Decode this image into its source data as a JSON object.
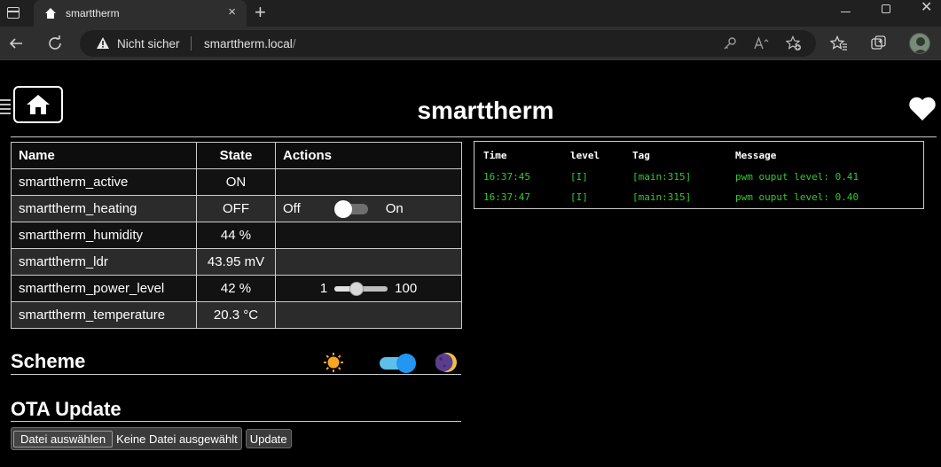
{
  "browser": {
    "tab_title": "smarttherm",
    "tab_close": "×",
    "new_tab": "+",
    "win_close": "✕",
    "not_secure": "Nicht sicher",
    "url_host": "smarttherm.local",
    "url_path": "/"
  },
  "page": {
    "title": "smarttherm"
  },
  "states_table": {
    "headers": {
      "name": "Name",
      "state": "State",
      "actions": "Actions"
    },
    "rows": [
      {
        "name": "smarttherm_active",
        "state": "ON"
      },
      {
        "name": "smarttherm_heating",
        "state": "OFF",
        "switch_off": "Off",
        "switch_on": "On",
        "switch_value": false
      },
      {
        "name": "smarttherm_humidity",
        "state": "44 %"
      },
      {
        "name": "smarttherm_ldr",
        "state": "43.95 mV"
      },
      {
        "name": "smarttherm_power_level",
        "state": "42 %",
        "slider_min": "1",
        "slider_max": "100",
        "slider_value": 42
      },
      {
        "name": "smarttherm_temperature",
        "state": "20.3 °C"
      }
    ]
  },
  "scheme": {
    "title": "Scheme",
    "dark_mode": true
  },
  "ota": {
    "title": "OTA Update",
    "choose_file": "Datei auswählen",
    "no_file": "Keine Datei ausgewählt",
    "update": "Update"
  },
  "log": {
    "headers": {
      "time": "Time",
      "level": "level",
      "tag": "Tag",
      "message": "Message"
    },
    "entries": [
      {
        "time": "16:37:45",
        "level": "[I]",
        "tag": "[main:315]",
        "message": "pwm ouput level: 0.41"
      },
      {
        "time": "16:37:47",
        "level": "[I]",
        "tag": "[main:315]",
        "message": "pwm ouput level: 0.40"
      }
    ],
    "text_color": "#2ecc2e"
  },
  "icons": {
    "window": "window-icon",
    "favicon": "house-icon",
    "back": "back-arrow-icon",
    "reload": "reload-icon",
    "warning": "warning-icon",
    "key": "key-icon",
    "read_aloud": "read-aloud-icon",
    "add_favorite": "add-favorite-icon",
    "favorites": "favorites-icon",
    "collections": "collections-icon",
    "home": "home-icon",
    "heart": "heart-icon",
    "sun": "sun-icon",
    "moon": "moon-icon"
  }
}
